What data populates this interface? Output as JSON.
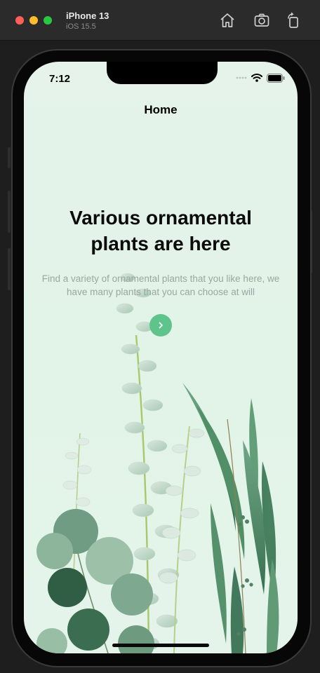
{
  "simulator": {
    "device_name": "iPhone 13",
    "os_version": "iOS 15.5",
    "toolbar": [
      "home-icon",
      "screenshot-icon",
      "rotate-icon"
    ]
  },
  "status_bar": {
    "time": "7:12",
    "icons": [
      "signal-icon",
      "wifi-icon",
      "battery-icon"
    ]
  },
  "nav": {
    "title": "Home"
  },
  "hero": {
    "headline": "Various ornamental plants are here",
    "subtitle": "Find a variety of ornamental plants that you like here, we have many plants that you can choose at will"
  },
  "next_button": {
    "icon": "chevron-right-icon"
  },
  "colors": {
    "background": "#e3f3e9",
    "accent": "#5ec48c",
    "leaf_dark": "#3f7a58",
    "leaf_light": "#9cc7a9"
  }
}
